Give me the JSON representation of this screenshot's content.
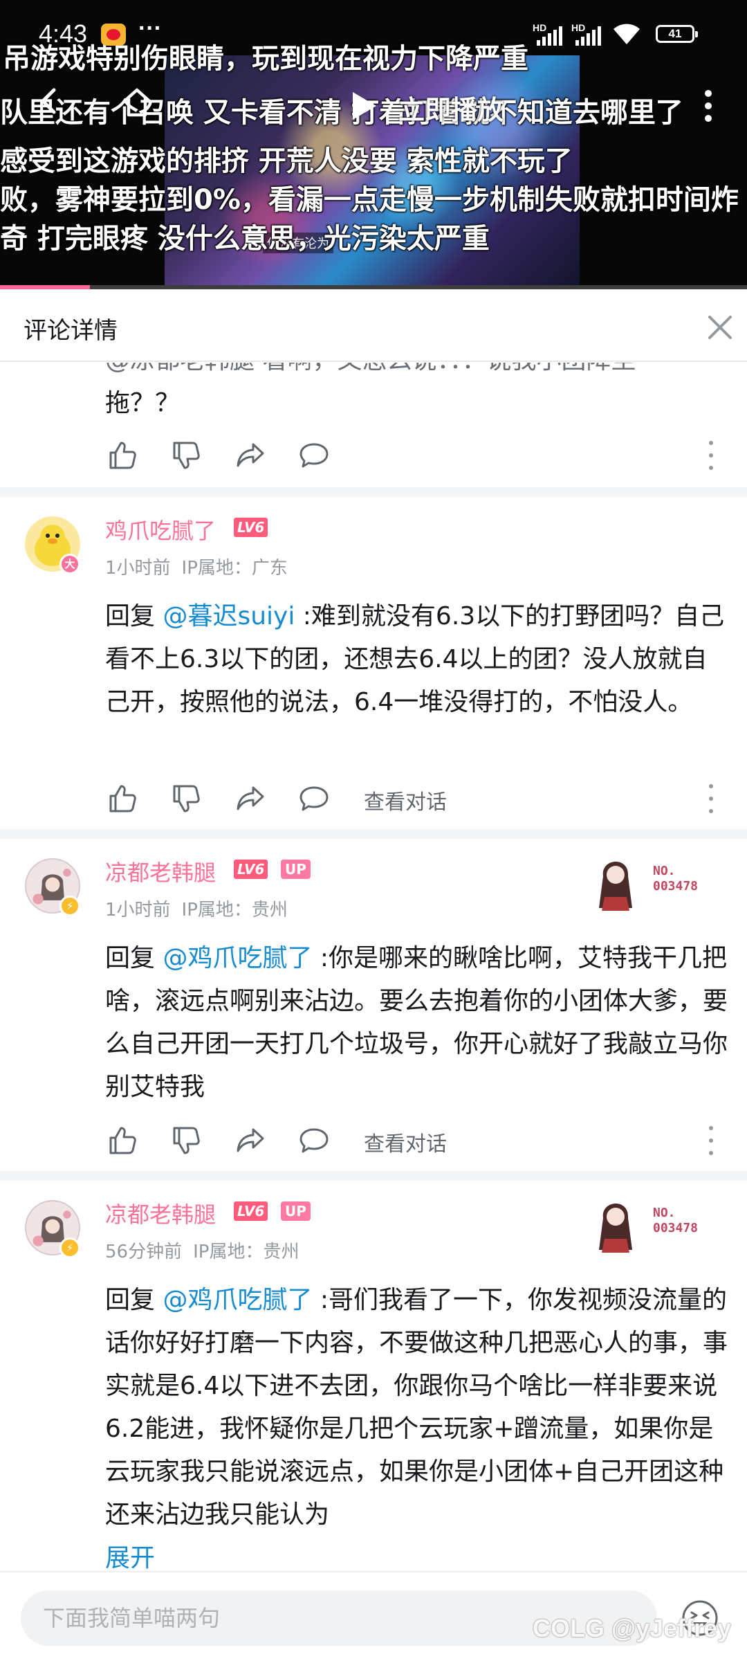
{
  "status_bar": {
    "time": "4:43",
    "more": "···",
    "hd_label": "HD",
    "battery": "41"
  },
  "video": {
    "danmaku": [
      "吊游戏特别伤眼睛，玩到现在视力下降严重",
      "队里还有个召唤 又卡看不清 打着打着就不知道去哪里了",
      "感受到这游戏的排挤 开荒人没要 索性就不玩了",
      "败，雾神要拉到0%，看漏一点走慢一步机制失败就扣时间炸",
      "奇      打完眼疼      没什么意思，光污染太严重"
    ],
    "hud_text": "你没有沦为",
    "play_now_label": "立即播放",
    "progress": 0.12
  },
  "header": {
    "title": "评论详情"
  },
  "replies": [
    {
      "partial_top": "@凉都老韩腿 看啊，又怎么说：：：说我小团降至",
      "text_tail": "拖？？"
    },
    {
      "username": "鸡爪吃腻了",
      "level": "LV6",
      "time": "1小时前",
      "ip": "IP属地：广东",
      "reply_prefix": "回复 ",
      "mention": "@暮迟suiyi",
      "text": " :难到就没有6.3以下的打野团吗？自己看不上6.3以下的团，还想去6.4以上的团？没人放就自己开，按照他的说法，6.4一堆没得打的，不怕没人。",
      "view_chat": "查看对话",
      "avatar_badge": "大"
    },
    {
      "username": "凉都老韩腿",
      "level": "LV6",
      "up": "UP",
      "time": "1小时前",
      "ip": "IP属地：贵州",
      "reply_prefix": "回复 ",
      "mention": "@鸡爪吃腻了",
      "text": " :你是哪来的瞅啥比啊，艾特我干几把啥，滚远点啊别来沾边。要么去抱着你的小团体大爹，要么自己开团一天打几个垃圾号，你开心就好了我敲立马你别艾特我",
      "view_chat": "查看对话",
      "fan_no_label": "NO.",
      "fan_no": "003478"
    },
    {
      "username": "凉都老韩腿",
      "level": "LV6",
      "up": "UP",
      "time": "56分钟前",
      "ip": "IP属地：贵州",
      "reply_prefix": "回复 ",
      "mention": "@鸡爪吃腻了",
      "text": " :哥们我看了一下，你发视频没流量的话你好好打磨一下内容，不要做这种几把恶心人的事，事实就是6.4以下进不去团，你跟你马个啥比一样非要来说6.2能进，我怀疑你是几把个云玩家+蹭流量，如果你是云玩家我只能说滚远点，如果你是小团体+自己开团这种还来沾边我只能认为",
      "expand": "展开",
      "fan_no_label": "NO.",
      "fan_no": "003478"
    }
  ],
  "bottom": {
    "placeholder": "下面我简单喵两句",
    "watermark": "COLG @yJeffrey"
  },
  "colors": {
    "accent_pink": "#fb7299",
    "mention_blue": "#178bcf",
    "meta_gray": "#9499a0"
  }
}
